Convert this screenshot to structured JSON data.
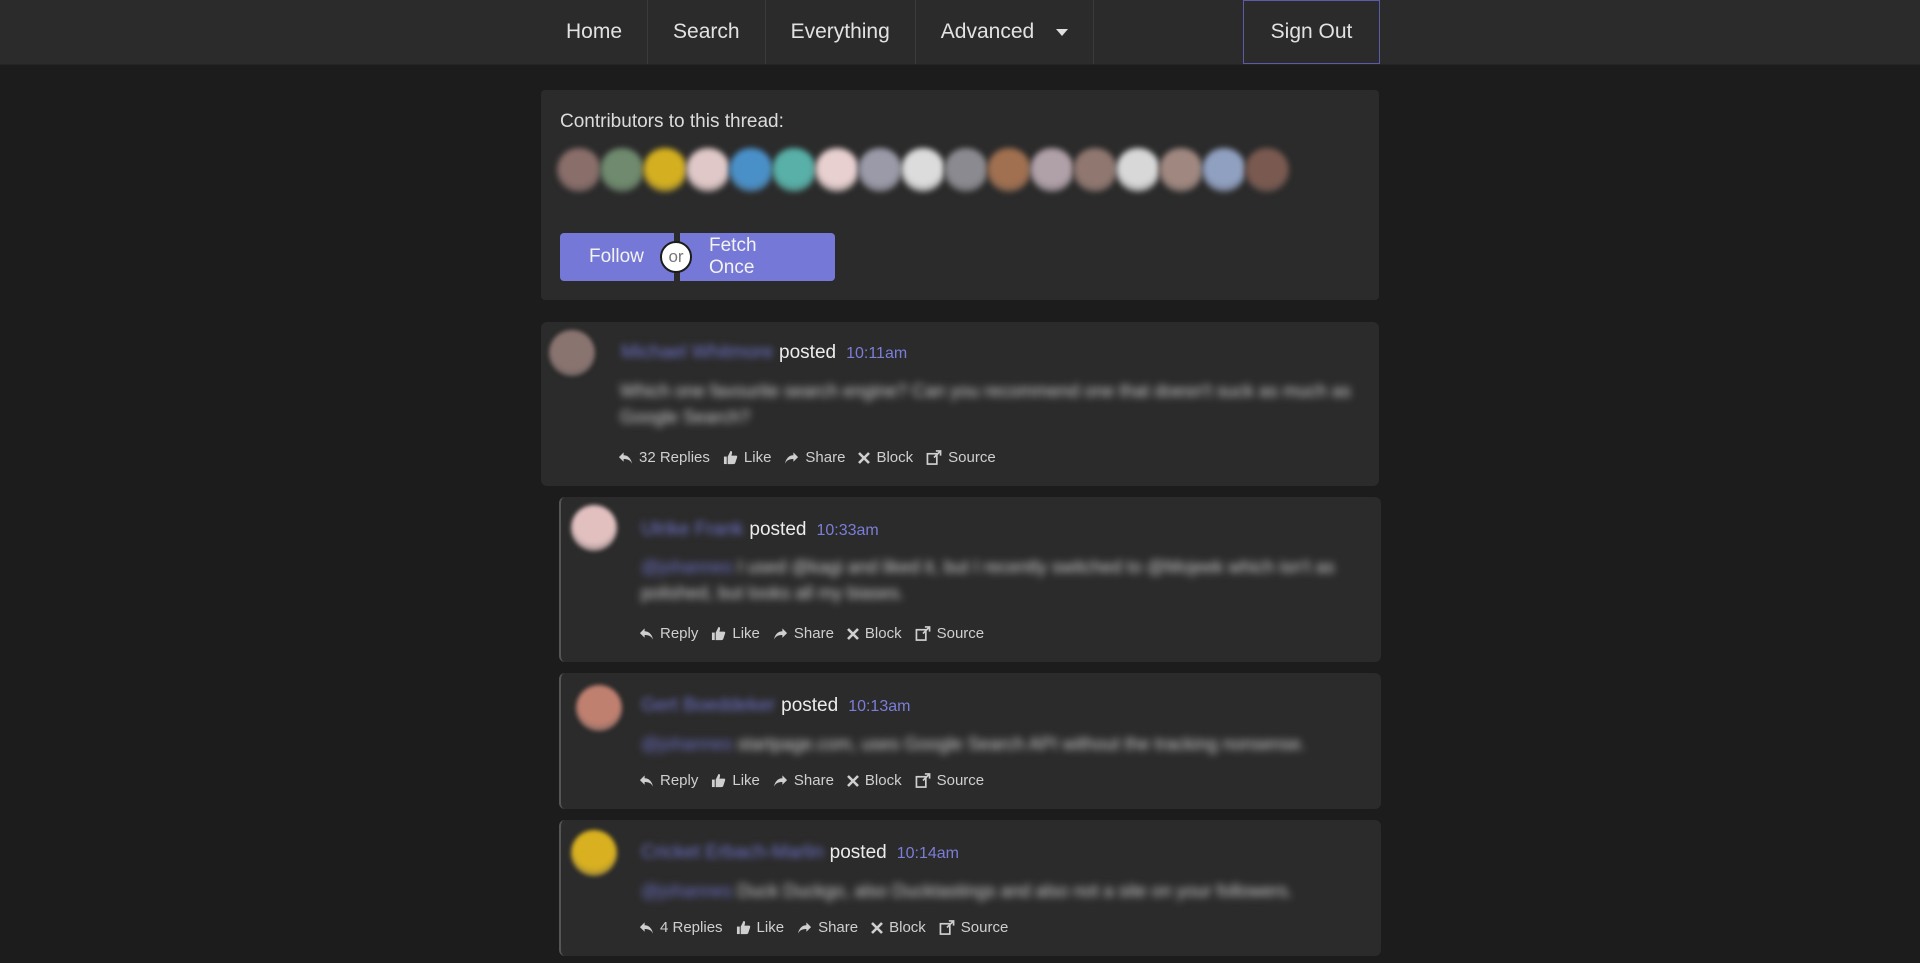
{
  "nav": {
    "home": "Home",
    "search": "Search",
    "everything": "Everything",
    "advanced": "Advanced",
    "sign_out": "Sign Out"
  },
  "contributors": {
    "title": "Contributors to this thread:",
    "avatar_colors": [
      "#8a6e6a",
      "#6f8a6e",
      "#d4b020",
      "#e0c8c8",
      "#4a90c8",
      "#58b0a8",
      "#e8d0d0",
      "#9a9aa8",
      "#dcdcdc",
      "#8a8a90",
      "#a07050",
      "#b0a0a8",
      "#907870",
      "#d8d8d8",
      "#a08880",
      "#90a0c0",
      "#7a5a50"
    ],
    "follow": "Follow",
    "or": "or",
    "fetch_once": "Fetch Once"
  },
  "posts": [
    {
      "author": "Michael Whitmore",
      "posted": "posted",
      "time": "10:11am",
      "body": "Which one favourite search engine? Can you recommend one that doesn't suck as much as Google Search?",
      "actions": {
        "replies": "32 Replies",
        "like": "Like",
        "share": "Share",
        "block": "Block",
        "source": "Source"
      },
      "avatar_color": "#8a7470"
    },
    {
      "author": "Ulrike Frank",
      "posted": "posted",
      "time": "10:33am",
      "mention": "@johannes",
      "body": "I used @kagi and liked it, but I recently switched to @Mojeek which isn't as polished, but looks all my biases.",
      "actions": {
        "replies": "Reply",
        "like": "Like",
        "share": "Share",
        "block": "Block",
        "source": "Source"
      },
      "avatar_color": "#e2c0c0"
    },
    {
      "author": "Gert Boeddeker",
      "posted": "posted",
      "time": "10:13am",
      "mention": "@johannes",
      "body": "startpage.com, uses Google Search API without the tracking nonsense.",
      "actions": {
        "replies": "Reply",
        "like": "Like",
        "share": "Share",
        "block": "Block",
        "source": "Source"
      },
      "avatar_color": "#c08070"
    },
    {
      "author": "Cricket Erbach-Marlin",
      "posted": "posted",
      "time": "10:14am",
      "mention": "@johannes",
      "body": "Duck Duckgo, also Ducktastings and also not a site on your followers.",
      "actions": {
        "replies": "4 Replies",
        "like": "Like",
        "share": "Share",
        "block": "Block",
        "source": "Source"
      },
      "avatar_color": "#d8b020"
    }
  ]
}
